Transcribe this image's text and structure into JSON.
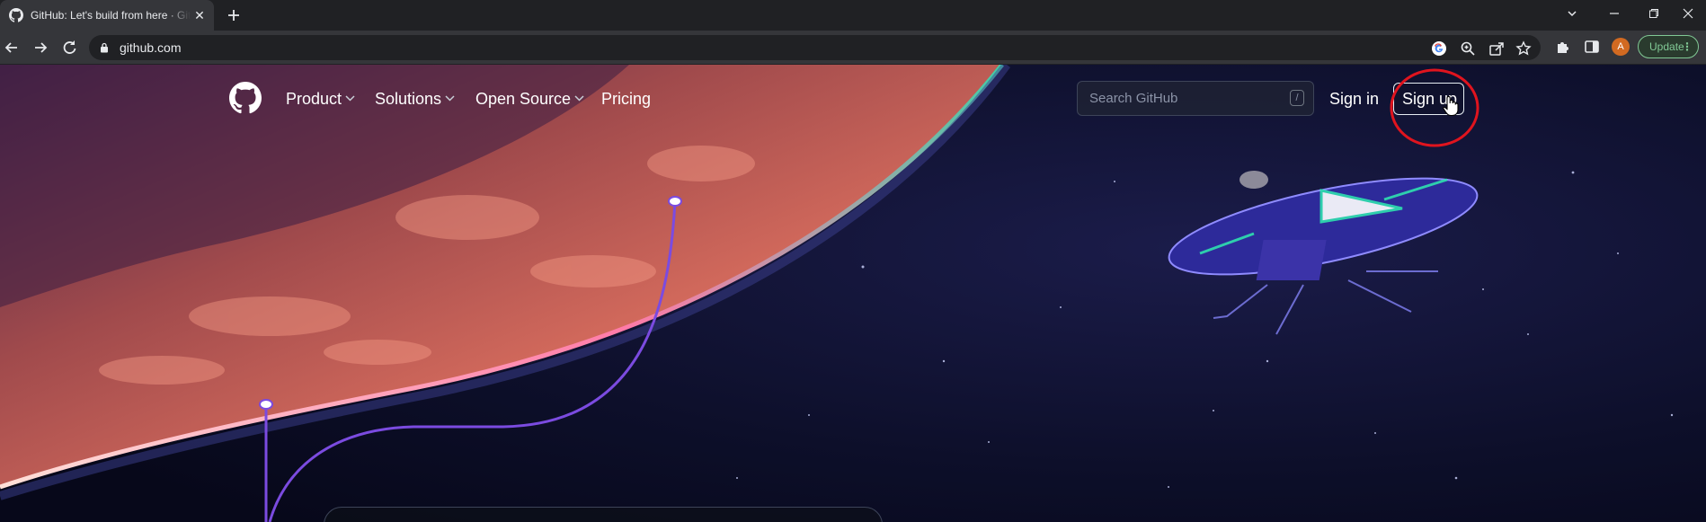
{
  "browser": {
    "tab_title": "GitHub: Let's build from here · GitHub",
    "url": "github.com",
    "profile_initial": "A",
    "update_label": "Update",
    "menu_glyph": "⋮"
  },
  "header": {
    "nav": [
      {
        "label": "Product",
        "has_menu": true
      },
      {
        "label": "Solutions",
        "has_menu": true
      },
      {
        "label": "Open Source",
        "has_menu": true
      },
      {
        "label": "Pricing",
        "has_menu": false
      }
    ],
    "search_placeholder": "Search GitHub",
    "search_shortcut": "/",
    "sign_in": "Sign in",
    "sign_up": "Sign up"
  },
  "colors": {
    "annotation": "#e0141e",
    "accent_purple": "#7b4be0",
    "update_green": "#81c995"
  }
}
